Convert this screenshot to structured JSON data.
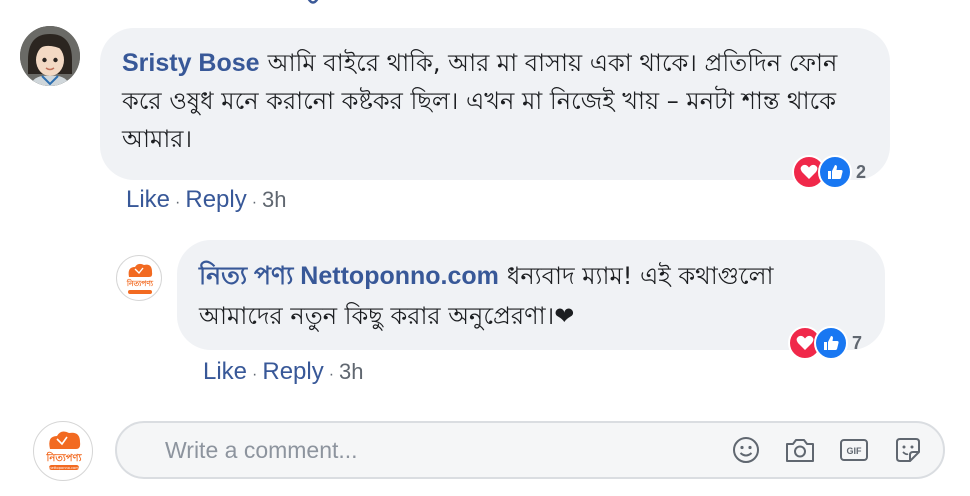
{
  "comments": [
    {
      "author": "Sristy Bose",
      "text": "আমি বাইরে থাকি, আর মা বাসায় একা থাকে। প্রতিদিন ফোন করে ওষুধ মনে করানো কষ্টকর ছিল। এখন মা নিজেই খায় – মনটা শান্ত থাকে আমার।",
      "reactions": {
        "icons": [
          "love-icon",
          "like-icon"
        ],
        "count": "2"
      },
      "actions": {
        "like": "Like",
        "reply": "Reply",
        "separator": "·",
        "time": "3h"
      }
    }
  ],
  "reply": {
    "author": "নিত্য পণ্য Nettoponno.com",
    "text": "ধন্যবাদ ম্যাম! এই কথাগুলো আমাদের নতুন কিছু করার অনুপ্রেরণা।❤",
    "reactions": {
      "icons": [
        "love-icon",
        "like-icon"
      ],
      "count": "7"
    },
    "actions": {
      "like": "Like",
      "reply": "Reply",
      "separator": "·",
      "time": "3h"
    }
  },
  "brand_logo": {
    "text": "নিত্যপণ্য",
    "sub": "nettoponno.com"
  },
  "composer": {
    "placeholder": "Write a comment...",
    "icons": [
      "emoji-icon",
      "camera-icon",
      "gif-icon",
      "sticker-icon"
    ]
  },
  "colors": {
    "link": "#385898",
    "bubble": "#f0f2f5",
    "love": "#f0284a",
    "like": "#1877f2",
    "brand_orange": "#f26a21"
  }
}
